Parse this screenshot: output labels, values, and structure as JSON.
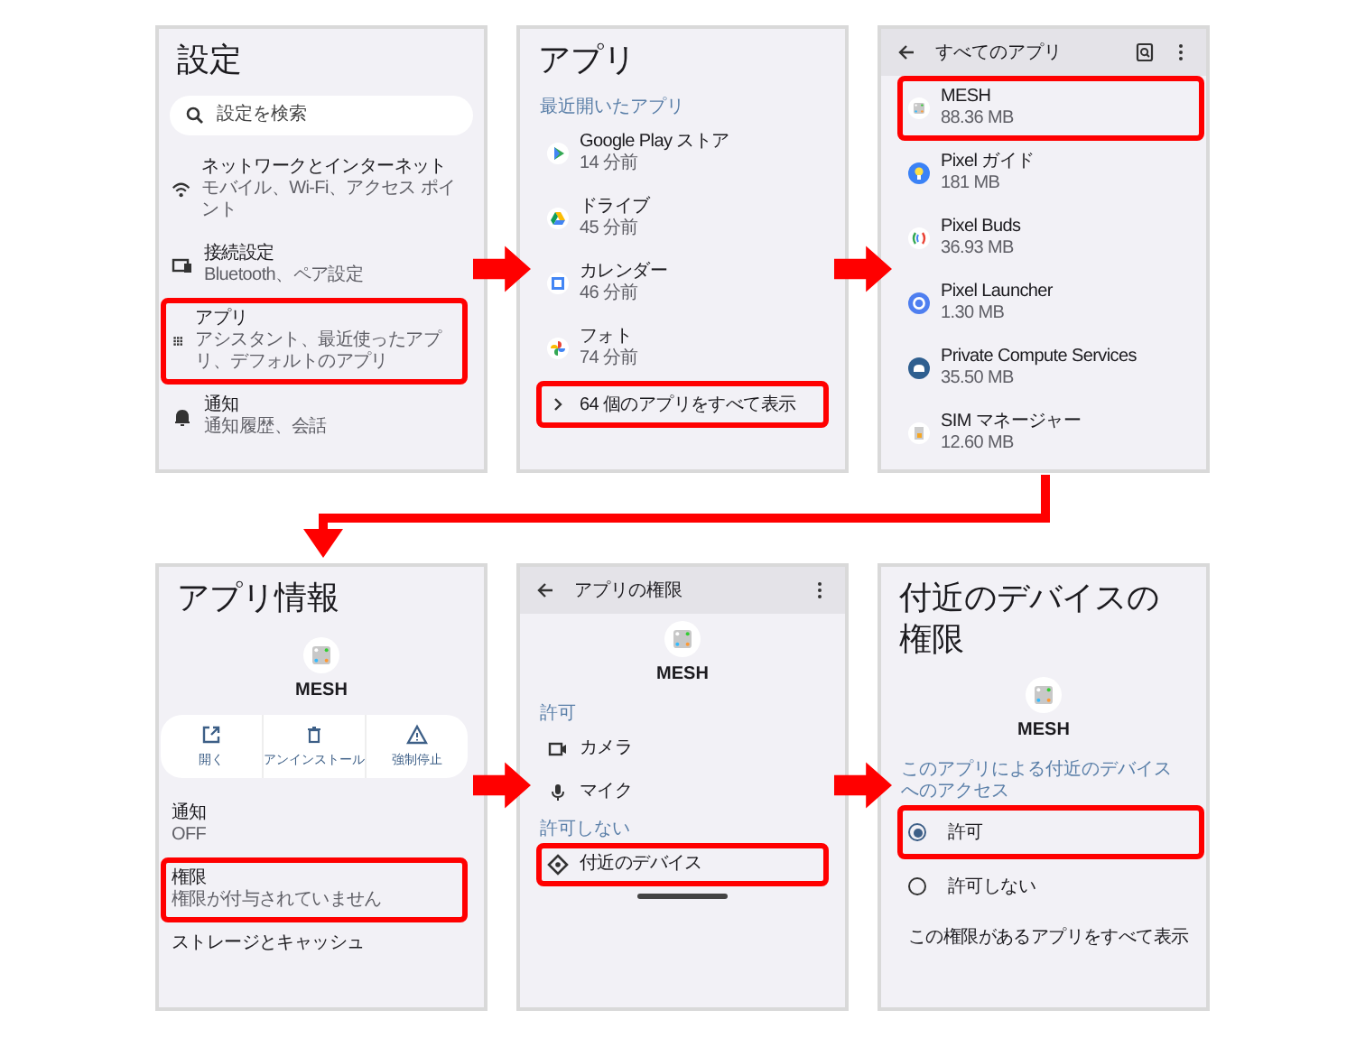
{
  "screens": [
    {
      "title": "設定",
      "search": {
        "placeholder": "設定を検索"
      },
      "list": [
        {
          "kind": "item",
          "title": "ネットワークとインターネット",
          "subtitle": "モバイル、Wi-Fi、アクセス ポイント",
          "highlighted": false
        },
        {
          "kind": "item",
          "title": "接続設定",
          "subtitle": "Bluetooth、ペア設定",
          "highlighted": false
        },
        {
          "kind": "item",
          "title": "アプリ",
          "subtitle": "アシスタント、最近使ったアプリ、デフォルトのアプリ",
          "highlighted": true
        },
        {
          "kind": "item",
          "title": "通知",
          "subtitle": "通知履歴、会話",
          "highlighted": false
        }
      ]
    },
    {
      "title": "アプリ",
      "list": [
        {
          "kind": "label",
          "text": "最近開いたアプリ"
        },
        {
          "kind": "item",
          "title": "Google Play ストア",
          "subtitle": "14 分前",
          "highlighted": false
        },
        {
          "kind": "item",
          "title": "ドライブ",
          "subtitle": "45 分前",
          "highlighted": false
        },
        {
          "kind": "item",
          "title": "カレンダー",
          "subtitle": "46 分前",
          "highlighted": false
        },
        {
          "kind": "item",
          "title": "フォト",
          "subtitle": "74 分前",
          "highlighted": false
        },
        {
          "kind": "link",
          "text": "64 個のアプリをすべて表示",
          "highlighted": true
        }
      ]
    },
    {
      "toolbar": {
        "title": "すべてのアプリ"
      },
      "list": [
        {
          "kind": "item",
          "title": "MESH",
          "subtitle": "88.36 MB",
          "highlighted": true
        },
        {
          "kind": "item",
          "title": "Pixel ガイド",
          "subtitle": "181 MB",
          "highlighted": false
        },
        {
          "kind": "item",
          "title": "Pixel Buds",
          "subtitle": "36.93 MB",
          "highlighted": false
        },
        {
          "kind": "item",
          "title": "Pixel Launcher",
          "subtitle": "1.30 MB",
          "highlighted": false
        },
        {
          "kind": "item",
          "title": "Private Compute Services",
          "subtitle": "35.50 MB",
          "highlighted": false
        },
        {
          "kind": "item",
          "title": "SIM マネージャー",
          "subtitle": "12.60 MB",
          "highlighted": false
        }
      ]
    },
    {
      "title": "アプリ情報",
      "app": {
        "name": "MESH"
      },
      "actions": [
        {
          "label": "開く"
        },
        {
          "label": "アンインストール"
        },
        {
          "label": "強制停止"
        }
      ],
      "list": [
        {
          "kind": "item",
          "title": "通知",
          "subtitle": "OFF",
          "highlighted": false
        },
        {
          "kind": "item",
          "title": "権限",
          "subtitle": "権限が付与されていません",
          "highlighted": true
        },
        {
          "kind": "item",
          "title": "ストレージとキャッシュ",
          "highlighted": false
        }
      ]
    },
    {
      "toolbar": {
        "title": "アプリの権限"
      },
      "app": {
        "name": "MESH"
      },
      "list": [
        {
          "kind": "label",
          "text": "許可"
        },
        {
          "kind": "item",
          "title": "カメラ",
          "highlighted": false
        },
        {
          "kind": "item",
          "title": "マイク",
          "highlighted": false
        },
        {
          "kind": "label",
          "text": "許可しない"
        },
        {
          "kind": "item",
          "title": "付近のデバイス",
          "highlighted": true
        }
      ]
    },
    {
      "title": "付近のデバイスの権限",
      "app": {
        "name": "MESH"
      },
      "list": [
        {
          "kind": "label",
          "text": "このアプリによる付近のデバイスへのアクセス"
        },
        {
          "kind": "radio",
          "label": "許可",
          "selected": true,
          "highlighted": true
        },
        {
          "kind": "radio",
          "label": "許可しない",
          "selected": false,
          "highlighted": false
        },
        {
          "kind": "link",
          "text": "この権限があるアプリをすべて表示",
          "highlighted": false
        }
      ]
    }
  ]
}
